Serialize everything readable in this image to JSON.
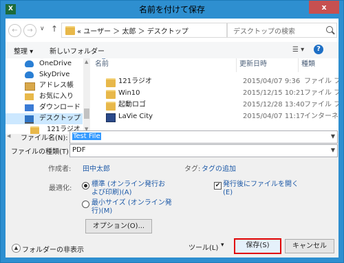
{
  "window": {
    "title": "名前を付けて保存",
    "app_icon": "excel-icon",
    "close_glyph": "x"
  },
  "nav": {
    "back_glyph": "←",
    "forward_glyph": "→",
    "dropdown_glyph": "∨",
    "up_glyph": "↑",
    "breadcrumb": "« ユーザー ＞ 太郎 ＞ デスクトップ",
    "refresh_glyph": "↻",
    "search_placeholder": "デスクトップの検索"
  },
  "toolbar": {
    "organize": "整理 ▾",
    "new_folder": "新しいフォルダー",
    "view_glyph": "☰ ▾",
    "help_glyph": "?"
  },
  "tree": [
    {
      "label": "OneDrive",
      "icon": "cloud"
    },
    {
      "label": "SkyDrive",
      "icon": "cloud"
    },
    {
      "label": "アドレス帳",
      "icon": "book"
    },
    {
      "label": "お気に入り",
      "icon": "star"
    },
    {
      "label": "ダウンロード",
      "icon": "dl"
    },
    {
      "label": "デスクトップ",
      "icon": "desk",
      "selected": true
    },
    {
      "label": "121ラジオ",
      "icon": "folder"
    }
  ],
  "columns": {
    "name": "名前",
    "date": "更新日時",
    "type": "種類"
  },
  "files": [
    {
      "name": "121ラジオ",
      "date": "2015/04/07 9:36",
      "type": "ファイル フォルダー",
      "icon": "folder"
    },
    {
      "name": "Win10",
      "date": "2015/12/15 10:21",
      "type": "ファイル フォルダー",
      "icon": "folder"
    },
    {
      "name": "起動ロゴ",
      "date": "2015/12/28 13:40",
      "type": "ファイル フォルダー",
      "icon": "folder"
    },
    {
      "name": "LaVie City",
      "date": "2015/04/07 11:17",
      "type": "インターネット ショ",
      "icon": "shortcut"
    }
  ],
  "form": {
    "filename_label": "ファイル名(N):",
    "filename_value": "Test File",
    "filetype_label": "ファイルの種類(T):",
    "filetype_value": "PDF",
    "author_label": "作成者:",
    "author_value": "田中太郎",
    "tags_label": "タグ:",
    "tags_value": "タグの追加"
  },
  "optimize": {
    "label": "最適化:",
    "standard_line1": "標準 (オンライン発行お",
    "standard_line2": "よび印刷)(A)",
    "minimum_line1": "最小サイズ (オンライン発",
    "minimum_line2": "行)(M)",
    "selected": "standard",
    "open_after_line1": "発行後にファイルを開く",
    "open_after_line2": "(E)",
    "open_after_checked": true,
    "options_button": "オプション(O)..."
  },
  "footer": {
    "hide_folders": "フォルダーの非表示",
    "tools": "ツール(L)",
    "tools_glyph": "▾",
    "save": "保存(S)",
    "cancel": "キャンセル"
  }
}
